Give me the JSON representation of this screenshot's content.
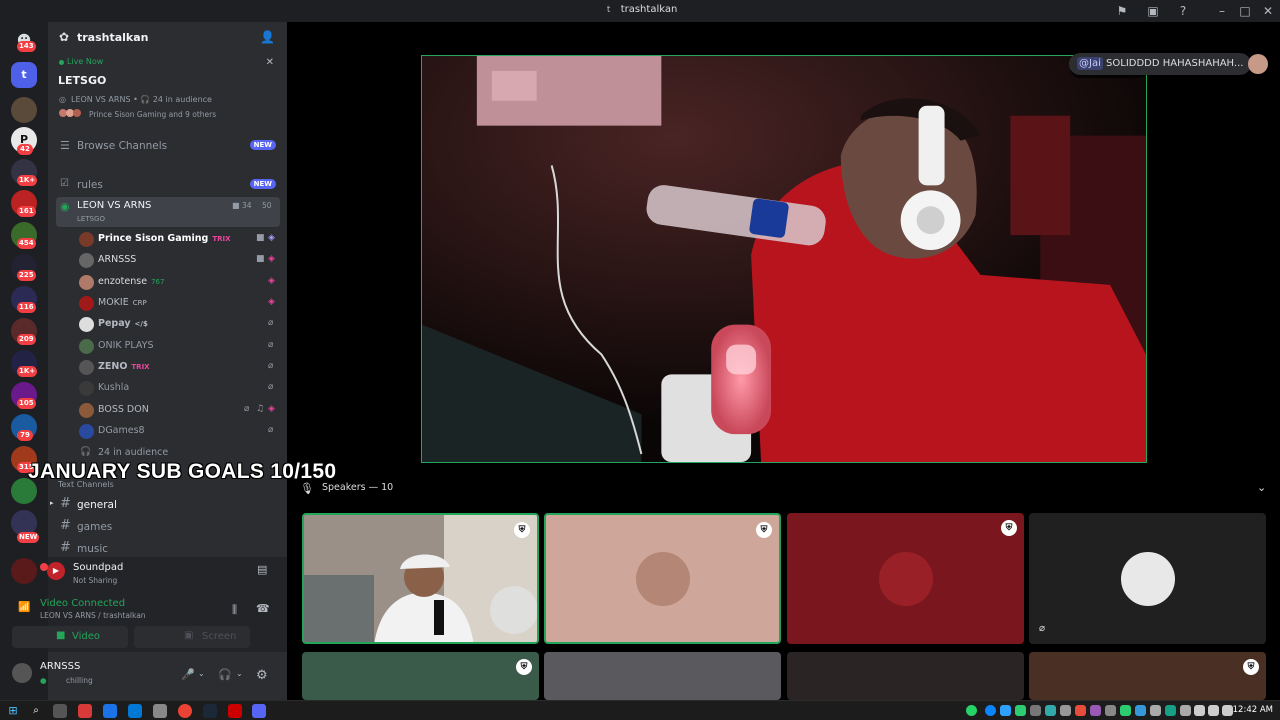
{
  "window": {
    "title": "trashtalkan"
  },
  "rail": {
    "badges": [
      "143",
      "42",
      "1K+",
      "161",
      "454",
      "225",
      "116",
      "209",
      "1K+",
      "105",
      "79",
      "315",
      "NEW"
    ]
  },
  "server": {
    "name": "trashtalkan"
  },
  "live": {
    "status": "Live Now",
    "event": "LETSGO",
    "meta": "LEON VS ARNS • 🎧 24 in audience",
    "people": "Prince Sison Gaming and 9 others"
  },
  "channels": {
    "browse": "Browse Channels",
    "rules": "rules",
    "new_label": "NEW",
    "stage_name": "LEON VS ARNS",
    "stage_sub": "LETSGO",
    "stage_count_a": "34",
    "stage_count_b": "50",
    "audience": "24 in audience",
    "text_header": "Text Channels",
    "general": "general",
    "games": "games",
    "music": "music"
  },
  "members": [
    {
      "name": "Prince Sison Gaming",
      "tag": "TRIX"
    },
    {
      "name": "ARNSSS",
      "tag": ""
    },
    {
      "name": "enzotense",
      "tag": "767"
    },
    {
      "name": "MOKIE",
      "tag": "CRP"
    },
    {
      "name": "Pepay",
      "tag": "</$"
    },
    {
      "name": "ONIK PLAYS",
      "tag": ""
    },
    {
      "name": "ZENO",
      "tag": "TRIX"
    },
    {
      "name": "Kushla",
      "tag": ""
    },
    {
      "name": "BOSS DON",
      "tag": ""
    },
    {
      "name": "DGames8",
      "tag": ""
    }
  ],
  "overlay": {
    "goal_text": "JANUARY SUB GOALS 10/150"
  },
  "soundpad": {
    "name": "Soundpad",
    "status": "Not Sharing"
  },
  "voice": {
    "status": "Video Connected",
    "location": "LEON VS ARNS / trashtalkan",
    "video_btn": "Video",
    "screen_btn": "Screen"
  },
  "user": {
    "name": "ARNSSS",
    "status": "chilling"
  },
  "stage": {
    "chat_mention": "@Jai",
    "chat_text": "SOLIDDDD HAHASHAHAH...",
    "speakers_label": "Speakers — 10"
  },
  "colors": {
    "accent": "#5865f2",
    "green": "#23a55a",
    "red": "#f23f43",
    "pink": "#eb459e"
  },
  "taskbar": {
    "clock": "12:42 AM"
  }
}
